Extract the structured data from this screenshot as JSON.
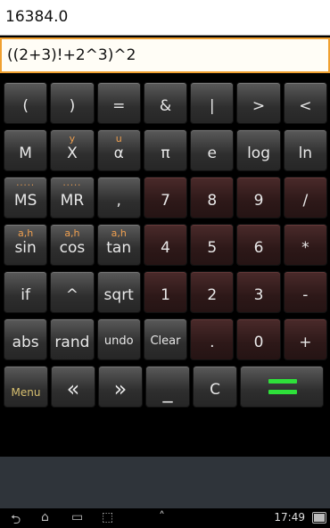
{
  "display": {
    "result": "16384.0",
    "expression": "((2+3)!+2^3)^2"
  },
  "keys": {
    "row1": [
      "(",
      ")",
      "=",
      "&",
      "|",
      ">",
      "<"
    ],
    "row2": [
      {
        "label": "M",
        "sup": ""
      },
      {
        "label": "X",
        "sup": "y"
      },
      {
        "label": "α",
        "sup": "u"
      },
      {
        "label": "π",
        "sup": ""
      },
      {
        "label": "e",
        "sup": ""
      },
      {
        "label": "log",
        "sup": ""
      },
      {
        "label": "ln",
        "sup": ""
      }
    ],
    "row3": [
      {
        "label": "MS",
        "sup": "....."
      },
      {
        "label": "MR",
        "sup": "....."
      },
      {
        "label": ",",
        "sup": ""
      },
      {
        "label": "7",
        "sup": ""
      },
      {
        "label": "8",
        "sup": ""
      },
      {
        "label": "9",
        "sup": ""
      },
      {
        "label": "/",
        "sup": ""
      }
    ],
    "row4": [
      {
        "label": "sin",
        "sup": "a,h"
      },
      {
        "label": "cos",
        "sup": "a,h"
      },
      {
        "label": "tan",
        "sup": "a,h"
      },
      {
        "label": "4",
        "sup": ""
      },
      {
        "label": "5",
        "sup": ""
      },
      {
        "label": "6",
        "sup": ""
      },
      {
        "label": "*",
        "sup": ""
      }
    ],
    "row5": [
      "if",
      "^",
      "sqrt",
      "1",
      "2",
      "3",
      "-"
    ],
    "row6": [
      "abs",
      "rand",
      "undo",
      "Clear",
      ".",
      "0",
      "+"
    ],
    "row7": {
      "menu": "Menu",
      "left": "«",
      "right": "»",
      "space": "_",
      "c": "C"
    }
  },
  "status": {
    "time": "17:49",
    "accent_color": "#2ee03a"
  }
}
